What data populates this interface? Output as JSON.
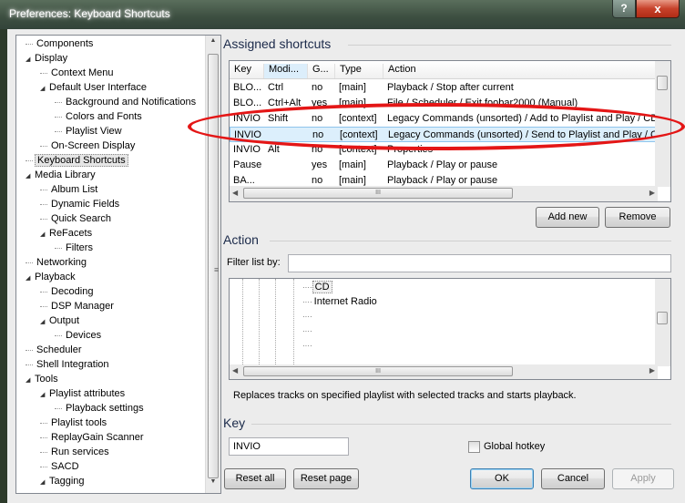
{
  "window": {
    "title": "Preferences: Keyboard Shortcuts",
    "help_glyph": "?",
    "close_glyph": "x"
  },
  "tree": {
    "items": [
      {
        "label": "Components",
        "level": 0,
        "arrow": ""
      },
      {
        "label": "Display",
        "level": 0,
        "arrow": "◢"
      },
      {
        "label": "Context Menu",
        "level": 1,
        "arrow": ""
      },
      {
        "label": "Default User Interface",
        "level": 1,
        "arrow": "◢"
      },
      {
        "label": "Background and Notifications",
        "level": 2,
        "arrow": ""
      },
      {
        "label": "Colors and Fonts",
        "level": 2,
        "arrow": ""
      },
      {
        "label": "Playlist View",
        "level": 2,
        "arrow": ""
      },
      {
        "label": "On-Screen Display",
        "level": 1,
        "arrow": ""
      },
      {
        "label": "Keyboard Shortcuts",
        "level": 0,
        "arrow": "",
        "selected": true
      },
      {
        "label": "Media Library",
        "level": 0,
        "arrow": "◢"
      },
      {
        "label": "Album List",
        "level": 1,
        "arrow": ""
      },
      {
        "label": "Dynamic Fields",
        "level": 1,
        "arrow": ""
      },
      {
        "label": "Quick Search",
        "level": 1,
        "arrow": ""
      },
      {
        "label": "ReFacets",
        "level": 1,
        "arrow": "◢"
      },
      {
        "label": "Filters",
        "level": 2,
        "arrow": ""
      },
      {
        "label": "Networking",
        "level": 0,
        "arrow": ""
      },
      {
        "label": "Playback",
        "level": 0,
        "arrow": "◢"
      },
      {
        "label": "Decoding",
        "level": 1,
        "arrow": ""
      },
      {
        "label": "DSP Manager",
        "level": 1,
        "arrow": ""
      },
      {
        "label": "Output",
        "level": 1,
        "arrow": "◢"
      },
      {
        "label": "Devices",
        "level": 2,
        "arrow": ""
      },
      {
        "label": "Scheduler",
        "level": 0,
        "arrow": ""
      },
      {
        "label": "Shell Integration",
        "level": 0,
        "arrow": ""
      },
      {
        "label": "Tools",
        "level": 0,
        "arrow": "◢"
      },
      {
        "label": "Playlist attributes",
        "level": 1,
        "arrow": "◢"
      },
      {
        "label": "Playback settings",
        "level": 2,
        "arrow": ""
      },
      {
        "label": "Playlist tools",
        "level": 1,
        "arrow": ""
      },
      {
        "label": "ReplayGain Scanner",
        "level": 1,
        "arrow": ""
      },
      {
        "label": "Run services",
        "level": 1,
        "arrow": ""
      },
      {
        "label": "SACD",
        "level": 1,
        "arrow": ""
      },
      {
        "label": "Tagging",
        "level": 1,
        "arrow": "◢"
      }
    ]
  },
  "assigned": {
    "title": "Assigned shortcuts",
    "columns": [
      "Key",
      "Modi...",
      "G...",
      "Type",
      "Action"
    ],
    "rows": [
      {
        "key": "BLO...",
        "mod": "Ctrl",
        "global": "no",
        "type": "[main]",
        "action": "Playback / Stop after current"
      },
      {
        "key": "BLO...",
        "mod": "Ctrl+Alt",
        "global": "yes",
        "type": "[main]",
        "action": "File / Scheduler / Exit foobar2000 (Manual)"
      },
      {
        "key": "INVIO",
        "mod": "Shift",
        "global": "no",
        "type": "[context]",
        "action": "Legacy Commands (unsorted) / Add to Playlist and Play / CD"
      },
      {
        "key": "INVIO",
        "mod": "",
        "global": "no",
        "type": "[context]",
        "action": "Legacy Commands (unsorted) / Send to Playlist and Play / CD"
      },
      {
        "key": "INVIO",
        "mod": "Alt",
        "global": "no",
        "type": "[context]",
        "action": "Properties"
      },
      {
        "key": "Pause",
        "mod": "",
        "global": "yes",
        "type": "[main]",
        "action": "Playback / Play or pause"
      },
      {
        "key": "BA...",
        "mod": "",
        "global": "no",
        "type": "[main]",
        "action": "Playback / Play or pause"
      }
    ],
    "add_label": "Add new",
    "remove_label": "Remove"
  },
  "action": {
    "title": "Action",
    "filter_label": "Filter list by:",
    "filter_value": "",
    "items": [
      {
        "label": "CD",
        "selected": true
      },
      {
        "label": "Internet Radio"
      },
      {
        "label": ""
      },
      {
        "label": ""
      },
      {
        "label": ""
      }
    ],
    "description": "Replaces tracks on specified playlist with selected tracks and starts playback."
  },
  "key": {
    "title": "Key",
    "value": "INVIO",
    "global_hotkey_label": "Global hotkey",
    "global_hotkey_checked": false
  },
  "footer": {
    "reset_all": "Reset all",
    "reset_page": "Reset page",
    "ok": "OK",
    "cancel": "Cancel",
    "apply": "Apply"
  },
  "colors": {
    "annotation": "#e41616",
    "highlight_row": "#dceffc",
    "section_title": "#1b2a4a"
  }
}
